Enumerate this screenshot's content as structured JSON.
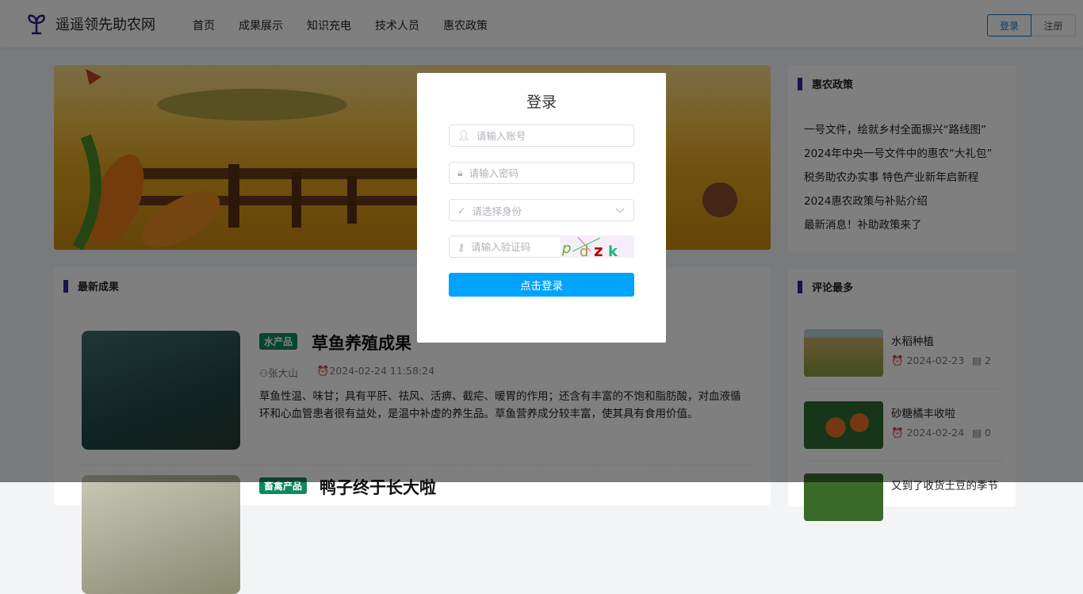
{
  "header": {
    "site_name": "遥遥领先助农网",
    "nav": [
      "首页",
      "成果展示",
      "知识充电",
      "技术人员",
      "惠农政策"
    ],
    "login": "登录",
    "register": "注册",
    "logo_color": "#2b1a8a"
  },
  "policy": {
    "title": "惠农政策",
    "items": [
      "一号文件，绘就乡村全面振兴“路线图”",
      "2024年中央一号文件中的惠农“大礼包”",
      "税务助农办实事 特色产业新年启新程",
      "2024惠农政策与补贴介绍",
      "最新消息！补助政策来了"
    ]
  },
  "latest": {
    "title": "最新成果",
    "items": [
      {
        "tag": "水产品",
        "title": "草鱼养殖成果",
        "author": "张大山",
        "time": "2024-02-24 11:58:24",
        "desc": "草鱼性温、味甘；具有平肝、祛风、活痹、截疟、暖胃的作用；还含有丰富的不饱和脂肪酸，对血液循环和心血管患者很有益处，是温中补虚的养生品。草鱼营养成分较丰富，使其具有食用价值。"
      },
      {
        "tag": "畜禽产品",
        "title": "鸭子终于长大啦"
      }
    ]
  },
  "comments": {
    "title": "评论最多",
    "items": [
      {
        "title": "水稻种植",
        "date": "2024-02-23",
        "count": "2"
      },
      {
        "title": "砂糖橘丰收啦",
        "date": "2024-02-24",
        "count": "0"
      },
      {
        "title": "又到了收货土豆的季节"
      }
    ]
  },
  "dialog": {
    "title": "登录",
    "account_placeholder": "请输入账号",
    "password_placeholder": "请输入密码",
    "role_placeholder": "请选择身份",
    "captcha_placeholder": "请输入验证码",
    "captcha_text": "pdzk",
    "submit": "点击登录",
    "accent": "#00a3ff"
  }
}
